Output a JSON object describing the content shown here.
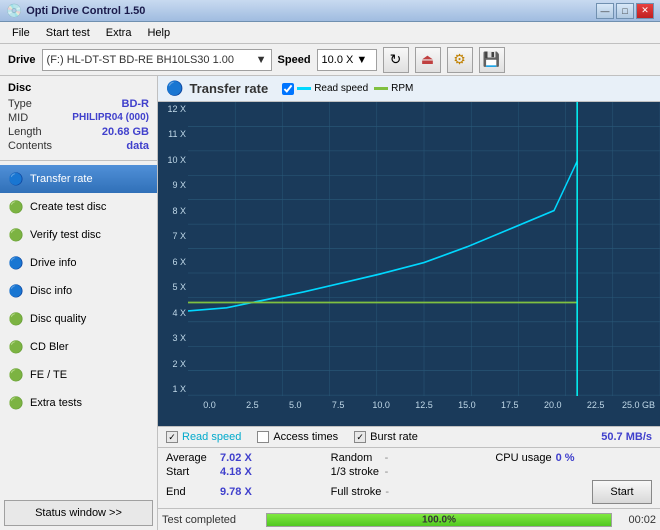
{
  "titleBar": {
    "icon": "💿",
    "title": "Opti Drive Control 1.50",
    "minBtn": "—",
    "maxBtn": "□",
    "closeBtn": "✕"
  },
  "menuBar": {
    "items": [
      "File",
      "Start test",
      "Extra",
      "Help"
    ]
  },
  "driveBar": {
    "driveLabel": "Drive",
    "driveValue": "(F:)  HL-DT-ST BD-RE  BH10LS30 1.00",
    "speedLabel": "Speed",
    "speedValue": "10.0 X ▼",
    "refreshIcon": "↻",
    "icon1": "🔴",
    "icon2": "💾"
  },
  "disc": {
    "title": "Disc",
    "rows": [
      {
        "key": "Type",
        "val": "BD-R"
      },
      {
        "key": "MID",
        "val": "PHILIPR04 (000)"
      },
      {
        "key": "Length",
        "val": "20.68 GB"
      },
      {
        "key": "Contents",
        "val": "data"
      }
    ]
  },
  "nav": {
    "items": [
      {
        "id": "transfer-rate",
        "icon": "🔵",
        "label": "Transfer rate",
        "active": true
      },
      {
        "id": "create-test-disc",
        "icon": "🟢",
        "label": "Create test disc",
        "active": false
      },
      {
        "id": "verify-test-disc",
        "icon": "🟢",
        "label": "Verify test disc",
        "active": false
      },
      {
        "id": "drive-info",
        "icon": "🔵",
        "label": "Drive info",
        "active": false
      },
      {
        "id": "disc-info",
        "icon": "🔵",
        "label": "Disc info",
        "active": false
      },
      {
        "id": "disc-quality",
        "icon": "🟢",
        "label": "Disc quality",
        "active": false
      },
      {
        "id": "cd-bler",
        "icon": "🟢",
        "label": "CD Bler",
        "active": false
      },
      {
        "id": "fe-te",
        "icon": "🟢",
        "label": "FE / TE",
        "active": false
      },
      {
        "id": "extra-tests",
        "icon": "🟢",
        "label": "Extra tests",
        "active": false
      }
    ],
    "statusWindowBtn": "Status window >>"
  },
  "chart": {
    "title": "Transfer rate",
    "icon": "🔵",
    "legend": [
      {
        "label": "Read speed",
        "color": "#00d8ff",
        "checked": true
      },
      {
        "label": "Access times",
        "color": "#c0c0c0",
        "checked": false
      },
      {
        "label": "Burst rate",
        "color": "#c0c0c0",
        "checked": true
      }
    ],
    "burstRate": {
      "label": "Burst rate",
      "value": "50.7 MB/s"
    },
    "yLabels": [
      "12 X",
      "11 X",
      "10 X",
      "9 X",
      "8 X",
      "7 X",
      "6 X",
      "5 X",
      "4 X",
      "3 X",
      "2 X",
      "1 X"
    ],
    "xLabels": [
      "0.0",
      "2.5",
      "5.0",
      "7.5",
      "10.0",
      "12.5",
      "15.0",
      "17.5",
      "20.0",
      "22.5",
      "25.0 GB"
    ]
  },
  "stats": {
    "average": {
      "key": "Average",
      "val": "7.02 X"
    },
    "random": {
      "key": "Random",
      "val": "-"
    },
    "cpuUsage": {
      "key": "CPU usage",
      "val": "0 %"
    },
    "start": {
      "key": "Start",
      "val": "4.18 X"
    },
    "oneThirdStroke": {
      "key": "1/3 stroke",
      "val": "-"
    },
    "end": {
      "key": "End",
      "val": "9.78 X"
    },
    "fullStroke": {
      "key": "Full stroke",
      "val": "-"
    },
    "startBtn": "Start"
  },
  "statusBar": {
    "statusText": "Test completed",
    "progress": 100,
    "progressText": "100.0%",
    "timer": "00:02"
  }
}
